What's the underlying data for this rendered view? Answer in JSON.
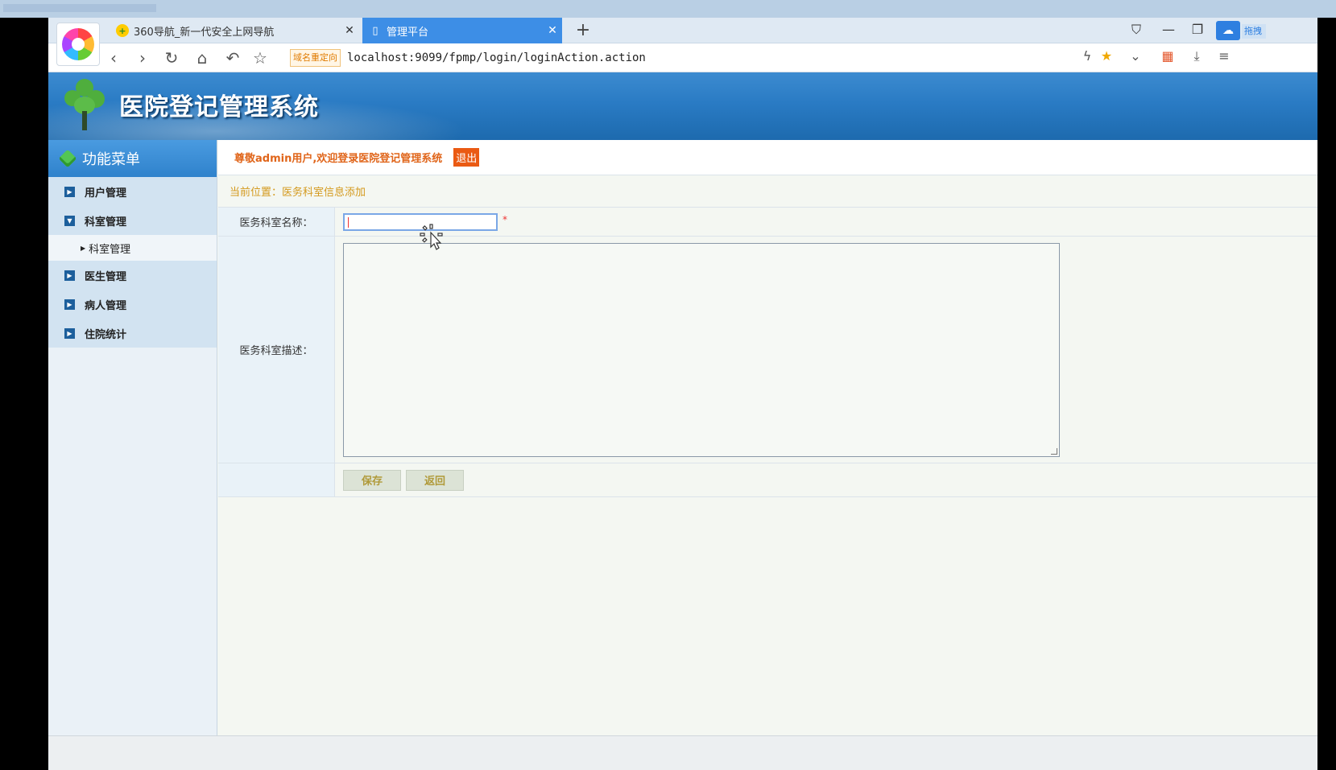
{
  "browser": {
    "tabs": [
      {
        "label": "360导航_新一代安全上网导航",
        "close": "✕"
      },
      {
        "label": "管理平台",
        "close": "✕"
      }
    ],
    "new_tab": "+",
    "redirect_badge": "域名重定向",
    "url": "localhost:9099/fpmp/login/loginAction.action",
    "side_label": "拖拽"
  },
  "app": {
    "title": "医院登记管理系统",
    "welcome": "尊敬admin用户,欢迎登录医院登记管理系统",
    "logout": "退出"
  },
  "sidebar": {
    "heading": "功能菜单",
    "items": [
      {
        "label": "用户管理"
      },
      {
        "label": "科室管理",
        "children": [
          {
            "label": "科室管理"
          }
        ]
      },
      {
        "label": "医生管理"
      },
      {
        "label": "病人管理"
      },
      {
        "label": "住院统计"
      }
    ]
  },
  "main": {
    "breadcrumb": "当前位置：医务科室信息添加",
    "form": {
      "name_label": "医务科室名称：",
      "name_value": "",
      "required_mark": "*",
      "desc_label": "医务科室描述：",
      "desc_value": "",
      "save": "保存",
      "back": "返回"
    }
  },
  "colors": {
    "header_blue": "#2a7bc4",
    "tab_active": "#3d8ee6",
    "welcome_orange": "#e0651a",
    "logout_bg": "#ea5a13",
    "breadcrumb": "#d49a1e"
  }
}
